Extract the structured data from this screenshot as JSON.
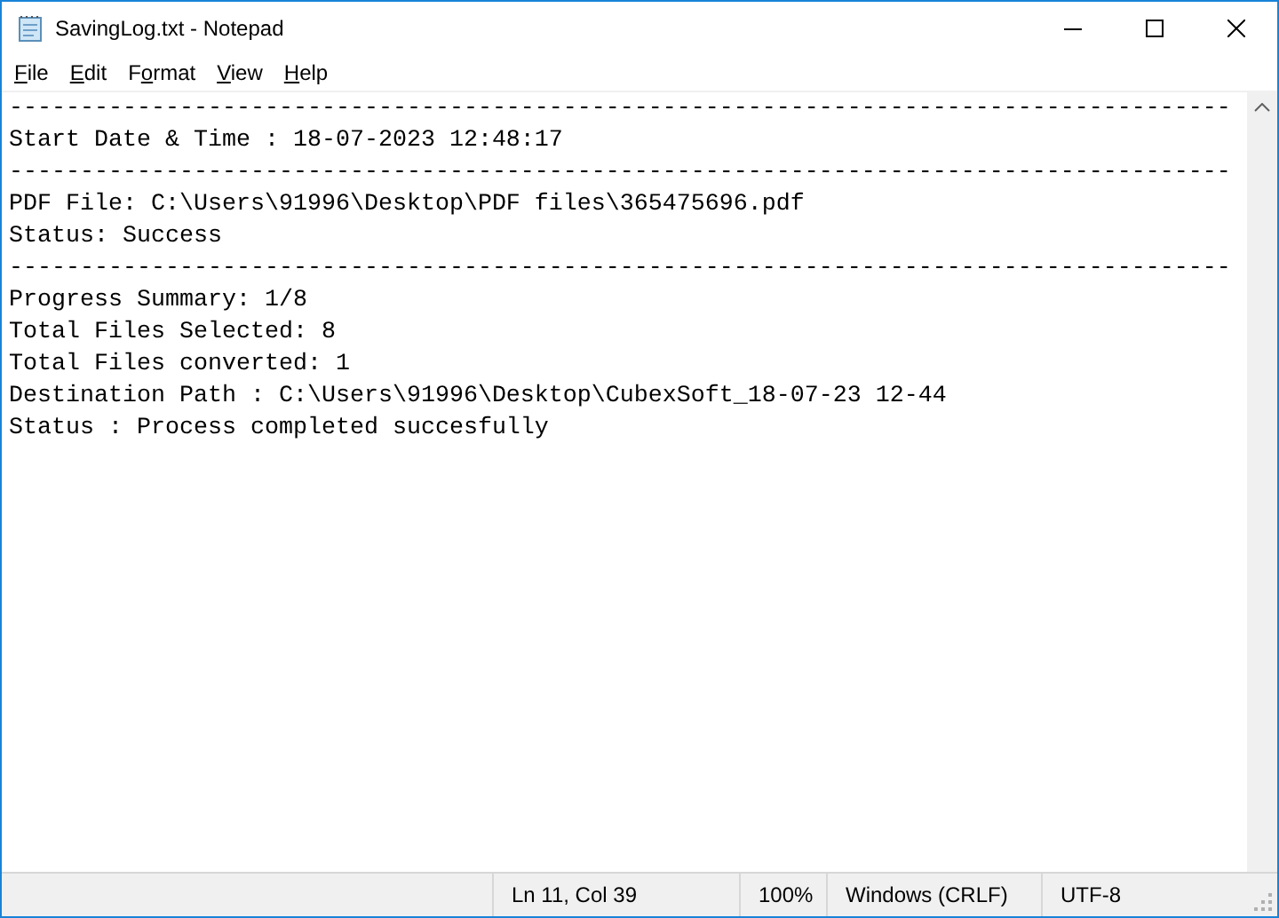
{
  "window": {
    "title": "SavingLog.txt - Notepad"
  },
  "menu": [
    {
      "key": "F",
      "post": "ile"
    },
    {
      "key": "E",
      "post": "dit"
    },
    {
      "pre": "F",
      "key": "o",
      "post": "rmat"
    },
    {
      "key": "V",
      "post": "iew"
    },
    {
      "key": "H",
      "post": "elp"
    }
  ],
  "document": {
    "lines": [
      "--------------------------------------------------------------------------------------",
      "Start Date & Time : 18-07-2023 12:48:17",
      "--------------------------------------------------------------------------------------",
      "PDF File: C:\\Users\\91996\\Desktop\\PDF files\\365475696.pdf",
      "Status: Success",
      "--------------------------------------------------------------------------------------",
      "Progress Summary: 1/8",
      "Total Files Selected: 8",
      "Total Files converted: 1",
      "Destination Path : C:\\Users\\91996\\Desktop\\CubexSoft_18-07-23 12-44",
      "Status : Process completed succesfully"
    ]
  },
  "status_bar": [
    {
      "text": "Ln 11, Col 39"
    },
    {
      "text": "100%"
    },
    {
      "text": "Windows (CRLF)"
    },
    {
      "text": "UTF-8"
    }
  ]
}
